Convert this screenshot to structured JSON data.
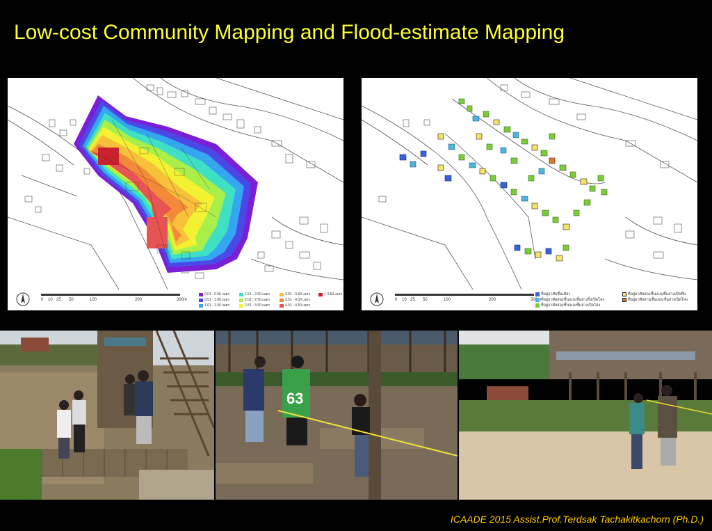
{
  "slide": {
    "title": "Low-cost Community Mapping and Flood-estimate Mapping",
    "footer": "ICAADE 2015  Assist.Prof.Terdsak Tachakitkachorn (Ph.D.)"
  },
  "flood_map": {
    "scale_ticks": [
      "0",
      "10",
      "25",
      "50",
      "100",
      "200",
      "300m"
    ],
    "legend": [
      {
        "label": "0.01 - 0.50 เมตร",
        "color": "#7a1fd6"
      },
      {
        "label": "0.51 - 1.00 เมตร",
        "color": "#4a49e8"
      },
      {
        "label": "1.01 - 1.50 เมตร",
        "color": "#35a6f0"
      },
      {
        "label": "1.51 - 2.00 เมตร",
        "color": "#3fe0c4"
      },
      {
        "label": "2.01 - 2.50 เมตร",
        "color": "#a8ef4a"
      },
      {
        "label": "2.51 - 3.00 เมตร",
        "color": "#f2f233"
      },
      {
        "label": "3.01 - 3.50 เมตร",
        "color": "#f7c13a"
      },
      {
        "label": "3.51 - 4.00 เมตร",
        "color": "#f38a3a"
      },
      {
        "label": "4.01 - 4.50 เมตร",
        "color": "#e85454"
      },
      {
        "label": "> 4.50 เมตร",
        "color": "#c8222e"
      }
    ]
  },
  "building_map": {
    "scale_ticks": [
      "0",
      "10",
      "25",
      "50",
      "100",
      "200",
      "300m"
    ],
    "legend": [
      {
        "label": "ที่อยู่อาศัยชั้นเดียว",
        "color": "#3a62d8",
        "border": "#3a62d8"
      },
      {
        "label": "ที่อยู่อาศัยสองชั้นแบบชั้นล่างกึ่งเปิดโล่ง",
        "color": "#4fb3e0",
        "border": "#4fb3e0"
      },
      {
        "label": "ที่อยู่อาศัยสองชั้นแบบชั้นล่างเปิดโล่ง",
        "color": "#7ccc3a",
        "border": "#7ccc3a"
      },
      {
        "label": "ที่อยู่อาศัยสองชั้นแบบชั้นล่างเปิดทึบ",
        "color": "#f5e26a",
        "border": "#222222"
      },
      {
        "label": "ที่อยู่อาศัยสามชั้นแบบชั้นล่างเปิดโล่ง",
        "color": "#e3782e",
        "border": "#222222"
      }
    ]
  }
}
